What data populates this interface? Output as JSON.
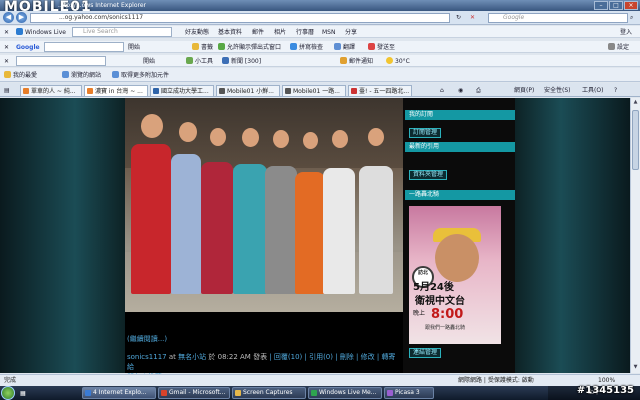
{
  "window": {
    "logo": "MOBILE01",
    "title": "...tp://...ows Internet Explorer"
  },
  "address": {
    "url": "http://tw.myblog.yahoo.com/sonics1117",
    "url_visible": "...og.yahoo.com/sonics1117",
    "search_placeholder": "Google"
  },
  "toolbar1": {
    "windows_live": "Windows Live",
    "live_search": "Live Search",
    "items": [
      "好友動態",
      "基本資料",
      "郵件",
      "相片",
      "行事曆",
      "MSN",
      "分享"
    ],
    "signin": "登入"
  },
  "toolbar2": {
    "google": "Google",
    "open": "開始",
    "bookmarks": "書籤",
    "popup": "允許顯示彈出式窗口",
    "spellcheck": "拼寫檢查",
    "translate": "翻譯",
    "send": "發送至",
    "settings": "設定"
  },
  "toolbar3": {
    "open": "開始",
    "tools": "小工具",
    "news": "新聞 [300]",
    "mail": "郵件通知",
    "weather": "30°C"
  },
  "favbar": {
    "favorites": "我的最愛",
    "item1": "瀏覽的網站",
    "item2": "取得更多附加元件"
  },
  "tabs": [
    {
      "label": "單車的人 ~ 純...",
      "active": false
    },
    {
      "label": "濃寶 in 台灣 ~ ...",
      "active": true
    },
    {
      "label": "國立成功大學工...",
      "active": false
    },
    {
      "label": "Mobile01 小鮮...",
      "active": false
    },
    {
      "label": "Mobile01 一路...",
      "active": false
    },
    {
      "label": "臺! - 五一四路北...",
      "active": false
    }
  ],
  "tab_tools": {
    "page": "網頁(P)",
    "safety": "安全性(S)",
    "tools": "工具(O)"
  },
  "post": {
    "more_link": "(繼續閱讀...)",
    "author": "sonics1117",
    "at": "at",
    "category": "無名小站",
    "on": "於",
    "time": "08:22 AM",
    "posted": "發表",
    "reply": "回覆(10)",
    "trackback": "引用(0)",
    "delete": "刪除",
    "edit": "修改",
    "forward": "轉寄給",
    "friend": "朋友",
    "recommend": "推薦"
  },
  "sidebar": {
    "my_subscriptions": "我的訂閱",
    "subscribe_manage": "訂閱管理",
    "recent_trackbacks": "最新的引用",
    "folder_manage": "資料夾管理",
    "ride_north": "一路轟北騎",
    "link_manage": "連結管理"
  },
  "ad": {
    "badge": "訪北",
    "date": "5月24後",
    "channel": "衛視中文台",
    "wan": "晚上",
    "time": "8:00",
    "tag": "跟我們一路轟北騎"
  },
  "status": {
    "done": "完成",
    "zone": "網際網路 | 受保護模式: 啟動",
    "zoom": "100%"
  },
  "taskbar": [
    {
      "label": "4 Internet Explo...",
      "color": "#3a7bd5",
      "active": true
    },
    {
      "label": "Gmail - Microsoft...",
      "color": "#d8432b",
      "active": false
    },
    {
      "label": "Screen Captures",
      "color": "#e6b84b",
      "active": false
    },
    {
      "label": "Windows Live Me...",
      "color": "#2ea44f",
      "active": false
    },
    {
      "label": "Picasa 3",
      "color": "#9a5fd0",
      "active": false
    }
  ],
  "tray": {
    "time": "上午"
  },
  "watermark": "#1345135"
}
